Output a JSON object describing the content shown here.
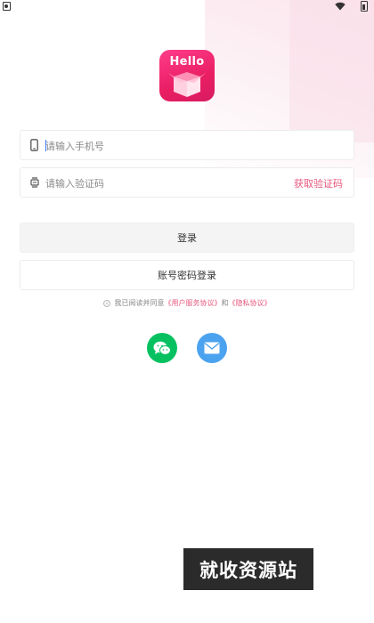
{
  "logo": {
    "text": "Hello"
  },
  "phone_field": {
    "placeholder": "请输入手机号",
    "value": ""
  },
  "code_field": {
    "placeholder": "请输入验证码",
    "value": "",
    "get_code_label": "获取验证码"
  },
  "buttons": {
    "login_label": "登录",
    "account_login_label": "账号密码登录"
  },
  "agreement": {
    "prefix": "我已阅读并同意",
    "user_agreement": "《用户服务协议》",
    "and": "和",
    "privacy_policy": "《隐私协议》"
  },
  "social": [
    "wechat-icon",
    "mail-icon"
  ],
  "watermark": {
    "text": "就收资源站"
  },
  "colors": {
    "accent": "#e7577f",
    "logo": "#e91e63",
    "wechat": "#07c160",
    "mail": "#4ba3f0",
    "button_bg": "#f4f4f4"
  }
}
